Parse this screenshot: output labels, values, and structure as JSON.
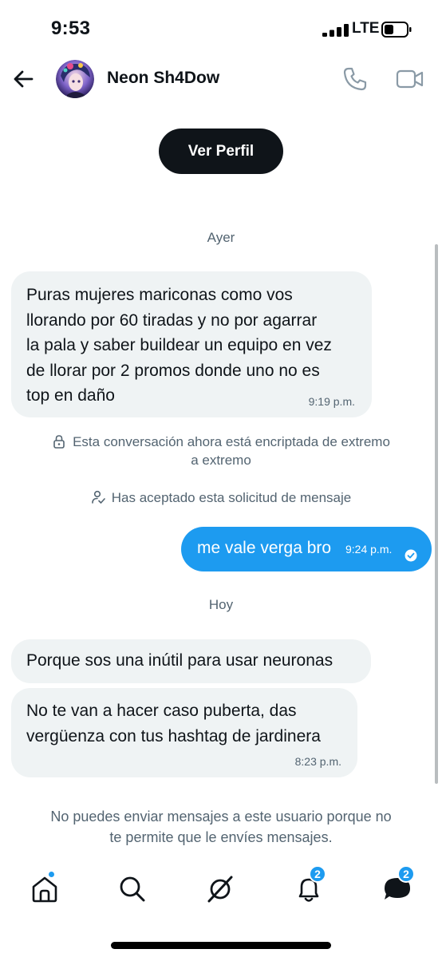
{
  "status_bar": {
    "time": "9:53",
    "network": "LTE"
  },
  "header": {
    "contact_name": "Neon Sh4Dow"
  },
  "profile_button_label": "Ver Perfil",
  "days": {
    "yesterday": "Ayer",
    "today": "Hoy"
  },
  "messages": [
    {
      "direction": "incoming",
      "lines": [
        "Puras mujeres mariconas como vos",
        "llorando por 60 tiradas y no por agarrar",
        "la pala y saber buildear un equipo en vez",
        "de  llorar por 2 promos donde uno no es",
        "top en daño"
      ],
      "time": "9:19 p.m."
    },
    {
      "direction": "outgoing",
      "lines": [
        "me vale verga bro"
      ],
      "time": "9:24 p.m.",
      "status": "read"
    },
    {
      "direction": "incoming",
      "lines": [
        "Porque sos una inútil para usar neuronas"
      ],
      "time": ""
    },
    {
      "direction": "incoming",
      "lines": [
        "No te van a hacer caso puberta, das",
        "vergüenza con tus hashtag de jardinera"
      ],
      "time": "8:23 p.m."
    }
  ],
  "system": {
    "encrypted_line1": "Esta conversación ahora está encriptada de extremo",
    "encrypted_line2": "a extremo",
    "accepted": "Has aceptado esta solicitud de mensaje"
  },
  "notice": {
    "line1": "No puedes enviar mensajes a este usuario porque no",
    "line2": "te permite que le envíes mensajes."
  },
  "nav": {
    "items": [
      {
        "name": "home",
        "icon": "home-icon",
        "indicator": "dot"
      },
      {
        "name": "search",
        "icon": "search-icon"
      },
      {
        "name": "grok",
        "icon": "grok-icon"
      },
      {
        "name": "notifications",
        "icon": "bell-icon",
        "badge": "2"
      },
      {
        "name": "messages",
        "icon": "messages-icon",
        "badge": "2"
      }
    ]
  },
  "colors": {
    "accent": "#1d9bf0",
    "incoming_bubble": "#eff3f4",
    "muted_text": "#536471",
    "primary_text": "#0f1419"
  }
}
